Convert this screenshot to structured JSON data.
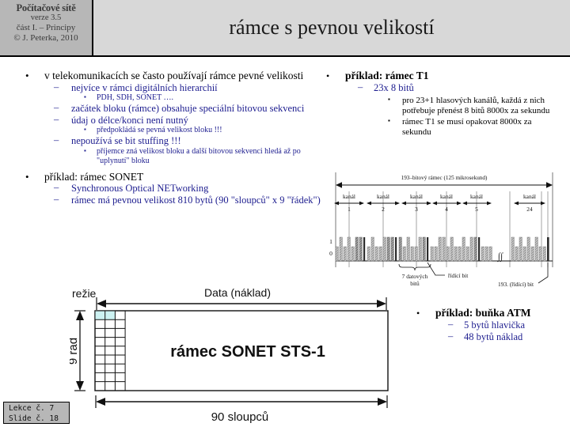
{
  "brand": {
    "line1": "Počítačové sítě",
    "line2": "verze 3.5",
    "line3": "část I.  –  Principy",
    "line4": "© J. Peterka, 2010"
  },
  "header": {
    "title": "rámce s pevnou velikostí",
    "band_color": "#d8d8d8",
    "brand_color": "#b7b7b7"
  },
  "left_column": {
    "bullet_glyph": "•",
    "dash_glyph": "–",
    "square_glyph": "▪",
    "items": [
      {
        "text": "v telekomunikacích  se často používají rámce  pevné velikosti",
        "children": [
          {
            "text": "nejvíce v rámci digitálních hierarchií",
            "children": [
              {
                "text": "PDH, SDH, SONET …."
              }
            ]
          },
          {
            "text": "začátek bloku (rámce) obsahuje speciální  bitovou sekvenci",
            "children": []
          },
          {
            "text": "údaj o délce/konci není nutný",
            "children": [
              {
                "text": "předpokládá se pevná velikost bloku !!!"
              }
            ]
          },
          {
            "text": "nepoužívá se bit stuffing !!!",
            "children": [
              {
                "text": "příjemce zná velikost bloku a další bitovou sekvenci hledá až po \"uplynutí\" bloku"
              }
            ]
          }
        ]
      },
      {
        "text": "příklad: rámec SONET",
        "children": [
          {
            "text": "Synchronous Optical NETworking",
            "children": []
          },
          {
            "text": "rámec má pevnou velikost 810 bytů (90 \"sloupců\" x 9 \"řádek\")",
            "children": []
          }
        ]
      }
    ]
  },
  "right_column": {
    "bullet_glyph": "•",
    "dash_glyph": "–",
    "square_glyph": "▪",
    "title": "příklad: rámec T1",
    "sub": "23x 8 bitů",
    "details": [
      "pro 23+1 hlasových kanálů, každá z nich potřebuje přenést 8 bitů 8000x za sekundu",
      "rámec T1 se musí opakovat 8000x za sekundu"
    ]
  },
  "t1_figure": {
    "frame_label": "193–bitový  rámec    (125  mikrosekund)",
    "channel_word": "kanál",
    "channel_numbers": [
      "1",
      "2",
      "3",
      "4",
      "5",
      "24"
    ],
    "axis_high": "1",
    "axis_low": "0",
    "annot_data_bits_1": "7  datových",
    "annot_data_bits_2": "bitů",
    "annot_control_bit": "řídící  bit",
    "annot_193_bit": "193. (řídící)  bit",
    "break_glyph": "∫∫"
  },
  "sonet_figure": {
    "overhead_label": "režie",
    "data_label": "Data (náklad)",
    "rows_label": "9 řad",
    "cols_label": "90 sloupců",
    "frame_text": "rámec SONET STS-1",
    "overhead_cols": 3,
    "overhead_rows": 9,
    "highlight_color": "#cdf2f2",
    "highlight_cells": [
      [
        0,
        0
      ],
      [
        0,
        1
      ]
    ]
  },
  "atm": {
    "bullet_glyph": "•",
    "dash_glyph": "–",
    "title": "příklad: buňka ATM",
    "items": [
      "5 bytů hlavička",
      "48 bytů náklad"
    ]
  },
  "footer": {
    "line1": "Lekce č. 7",
    "line2": "Slide č. 18"
  }
}
